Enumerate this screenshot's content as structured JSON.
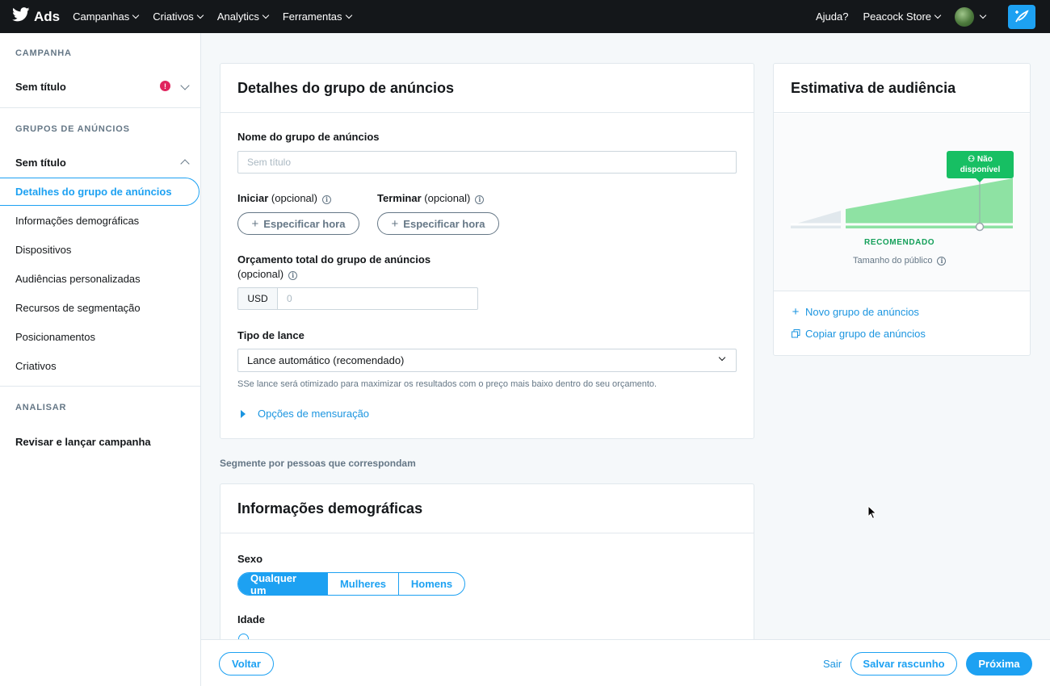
{
  "nav": {
    "brand": "Ads",
    "items": [
      "Campanhas",
      "Criativos",
      "Analytics",
      "Ferramentas"
    ],
    "help": "Ajuda?",
    "account": "Peacock Store",
    "icons": {
      "logo": "twitter-bird-icon",
      "compose": "compose-tweet-icon"
    }
  },
  "sidebar": {
    "campaign_section": "CAMPANHA",
    "campaign_name": "Sem título",
    "campaign_alert": "!",
    "adgroups_section": "GRUPOS DE ANÚNCIOS",
    "adgroup_name": "Sem título",
    "items": [
      "Detalhes do grupo de anúncios",
      "Informações demográficas",
      "Dispositivos",
      "Audiências personalizadas",
      "Recursos de segmentação",
      "Posicionamentos",
      "Criativos"
    ],
    "analyze_section": "ANALISAR",
    "review": "Revisar e lançar campanha"
  },
  "details": {
    "title": "Detalhes do grupo de anúncios",
    "name_label": "Nome do grupo de anúncios",
    "name_placeholder": "Sem título",
    "start_label": "Iniciar",
    "end_label": "Terminar",
    "optional": "(opcional)",
    "specify_time": "Especificar hora",
    "budget_label": "Orçamento total do grupo de anúncios",
    "budget_optional": "(opcional)",
    "currency": "USD",
    "budget_placeholder": "0",
    "bid_label": "Tipo de lance",
    "bid_value": "Lance automático (recomendado)",
    "bid_hint": "SSe lance será otimizado para maximizar os resultados com o preço mais baixo dentro do seu orçamento.",
    "measurement": "Opções de mensuração"
  },
  "segment_label": "Segmente por pessoas que correspondam",
  "demographics": {
    "title": "Informações demográficas",
    "gender_label": "Sexo",
    "gender_options": [
      "Qualquer um",
      "Mulheres",
      "Homens"
    ],
    "gender_selected": "Qualquer um",
    "age_label": "Idade"
  },
  "audience": {
    "title": "Estimativa de audiência",
    "tooltip_line1": "Não",
    "tooltip_line2": "disponível",
    "recommended": "RECOMENDADO",
    "public_size": "Tamanho do público",
    "new_group": "Novo grupo de anúncios",
    "copy_group": "Copiar grupo de anúncios",
    "colors": {
      "accent": "#17bf63",
      "fill": "#8ee2a3"
    }
  },
  "footer": {
    "back": "Voltar",
    "exit": "Sair",
    "save_draft": "Salvar rascunho",
    "next": "Próxima"
  },
  "colors": {
    "primary": "#1da1f2",
    "topbar": "#14171a",
    "error": "#e0245e"
  }
}
